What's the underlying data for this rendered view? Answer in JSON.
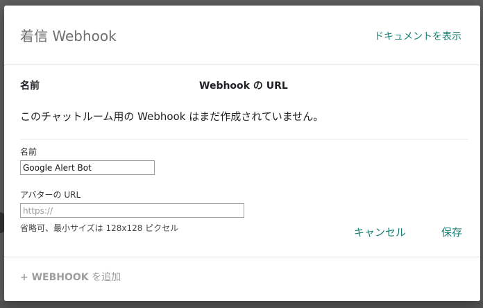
{
  "dialog": {
    "title": "着信 Webhook",
    "docs_link": "ドキュメントを表示"
  },
  "table": {
    "col_name": "名前",
    "col_url": "Webhook の URL",
    "empty_message": "このチャットルーム用の Webhook はまだ作成されていません。"
  },
  "form": {
    "name_label": "名前",
    "name_value": "Google Alert Bot",
    "avatar_label": "アバターの URL",
    "avatar_placeholder": "https://",
    "avatar_hint": "省略可、最小サイズは 128x128 ピクセル",
    "cancel_label": "キャンセル",
    "save_label": "保存"
  },
  "footer": {
    "add_plus": "+ ",
    "add_label": "WEBHOOK",
    "add_suffix": " を追加"
  },
  "colors": {
    "accent": "#1a7f73",
    "muted": "#9e9e9e"
  }
}
